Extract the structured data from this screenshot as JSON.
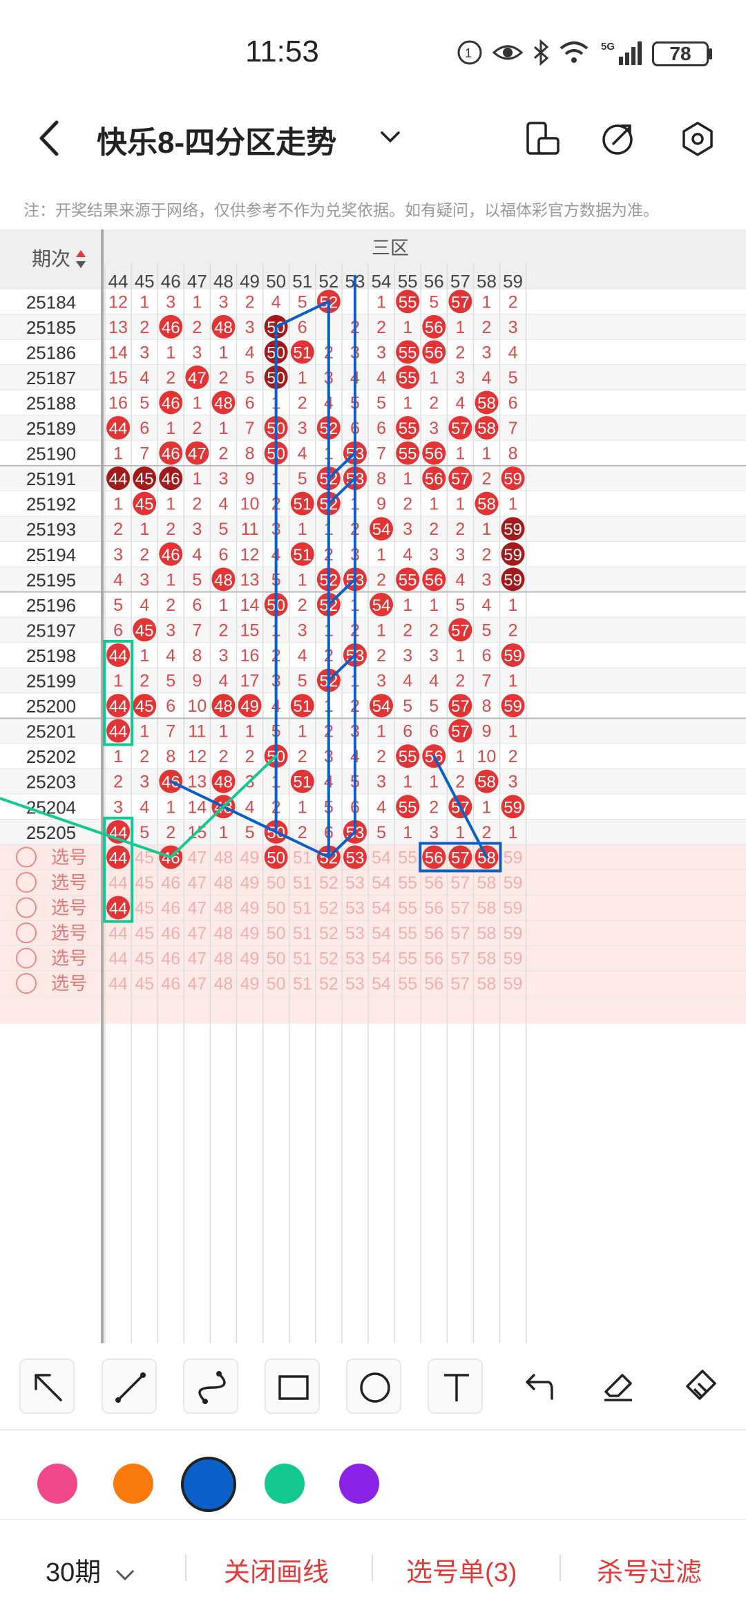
{
  "status_bar": {
    "time": "11:53",
    "battery": "78"
  },
  "header": {
    "title": "快乐8-四分区走势"
  },
  "notice": "注：开奖结果来源于网络，仅供参考不作为兑奖依据。如有疑问，以福体彩官方数据为准。",
  "table": {
    "period_header": "期次",
    "zone_label": "三区",
    "columns": [
      44,
      45,
      46,
      47,
      48,
      49,
      50,
      51,
      52,
      53,
      54,
      55,
      56,
      57,
      58,
      59
    ],
    "rows": [
      {
        "period": "25184",
        "cells": [
          "12",
          "1",
          "3",
          "1",
          "3",
          "2",
          "4",
          "5",
          "52",
          "",
          "1",
          "55",
          "5",
          "57",
          "1",
          "2"
        ]
      },
      {
        "period": "25185",
        "cells": [
          "13",
          "2",
          "46",
          "2",
          "48",
          "3",
          "50",
          "6",
          "",
          "2",
          "2",
          "1",
          "56",
          "1",
          "2",
          "3"
        ]
      },
      {
        "period": "25186",
        "cells": [
          "14",
          "3",
          "1",
          "3",
          "1",
          "4",
          "50",
          "51",
          "2",
          "3",
          "3",
          "55",
          "56",
          "2",
          "3",
          "4"
        ]
      },
      {
        "period": "25187",
        "cells": [
          "15",
          "4",
          "2",
          "47",
          "2",
          "5",
          "50",
          "1",
          "3",
          "4",
          "4",
          "55",
          "1",
          "3",
          "4",
          "5"
        ]
      },
      {
        "period": "25188",
        "cells": [
          "16",
          "5",
          "46",
          "1",
          "48",
          "6",
          "1",
          "2",
          "4",
          "5",
          "5",
          "1",
          "2",
          "4",
          "58",
          "6"
        ]
      },
      {
        "period": "25189",
        "cells": [
          "44",
          "6",
          "1",
          "2",
          "1",
          "7",
          "50",
          "3",
          "52",
          "6",
          "6",
          "55",
          "3",
          "57",
          "58",
          "7"
        ]
      },
      {
        "period": "25190",
        "cells": [
          "1",
          "7",
          "46",
          "47",
          "2",
          "8",
          "50",
          "4",
          "1",
          "53",
          "7",
          "55",
          "56",
          "1",
          "1",
          "8"
        ]
      },
      {
        "period": "25191",
        "cells": [
          "44",
          "45",
          "46",
          "1",
          "3",
          "9",
          "1",
          "5",
          "52",
          "53",
          "8",
          "1",
          "56",
          "57",
          "2",
          "59"
        ]
      },
      {
        "period": "25192",
        "cells": [
          "1",
          "45",
          "1",
          "2",
          "4",
          "10",
          "2",
          "51",
          "52",
          "1",
          "9",
          "2",
          "1",
          "1",
          "58",
          "1"
        ]
      },
      {
        "period": "25193",
        "cells": [
          "2",
          "1",
          "2",
          "3",
          "5",
          "11",
          "3",
          "1",
          "1",
          "2",
          "54",
          "3",
          "2",
          "2",
          "1",
          "59"
        ]
      },
      {
        "period": "25194",
        "cells": [
          "3",
          "2",
          "46",
          "4",
          "6",
          "12",
          "4",
          "51",
          "2",
          "3",
          "1",
          "4",
          "3",
          "3",
          "2",
          "59"
        ]
      },
      {
        "period": "25195",
        "cells": [
          "4",
          "3",
          "1",
          "5",
          "48",
          "13",
          "5",
          "1",
          "52",
          "53",
          "2",
          "55",
          "56",
          "4",
          "3",
          "59"
        ]
      },
      {
        "period": "25196",
        "cells": [
          "5",
          "4",
          "2",
          "6",
          "1",
          "14",
          "50",
          "2",
          "52",
          "1",
          "54",
          "1",
          "1",
          "5",
          "4",
          "1"
        ]
      },
      {
        "period": "25197",
        "cells": [
          "6",
          "45",
          "3",
          "7",
          "2",
          "15",
          "1",
          "3",
          "1",
          "2",
          "1",
          "2",
          "2",
          "57",
          "5",
          "2"
        ]
      },
      {
        "period": "25198",
        "cells": [
          "44",
          "1",
          "4",
          "8",
          "3",
          "16",
          "2",
          "4",
          "2",
          "53",
          "2",
          "3",
          "3",
          "1",
          "6",
          "59"
        ]
      },
      {
        "period": "25199",
        "cells": [
          "1",
          "2",
          "5",
          "9",
          "4",
          "17",
          "3",
          "5",
          "52",
          "1",
          "3",
          "4",
          "4",
          "2",
          "7",
          "1"
        ]
      },
      {
        "period": "25200",
        "cells": [
          "44",
          "45",
          "6",
          "10",
          "48",
          "49",
          "4",
          "51",
          "1",
          "2",
          "54",
          "5",
          "5",
          "57",
          "8",
          "59"
        ]
      },
      {
        "period": "25201",
        "cells": [
          "44",
          "1",
          "7",
          "11",
          "1",
          "1",
          "5",
          "1",
          "2",
          "3",
          "1",
          "6",
          "6",
          "57",
          "9",
          "1"
        ]
      },
      {
        "period": "25202",
        "cells": [
          "1",
          "2",
          "8",
          "12",
          "2",
          "2",
          "50",
          "2",
          "3",
          "4",
          "2",
          "55",
          "56",
          "1",
          "10",
          "2"
        ]
      },
      {
        "period": "25203",
        "cells": [
          "2",
          "3",
          "46",
          "13",
          "48",
          "3",
          "1",
          "51",
          "4",
          "5",
          "3",
          "1",
          "1",
          "2",
          "58",
          "3"
        ]
      },
      {
        "period": "25204",
        "cells": [
          "3",
          "4",
          "1",
          "14",
          "48",
          "4",
          "2",
          "1",
          "5",
          "6",
          "4",
          "55",
          "2",
          "57",
          "1",
          "59"
        ]
      },
      {
        "period": "25205",
        "cells": [
          "44",
          "5",
          "2",
          "15",
          "1",
          "5",
          "50",
          "2",
          "6",
          "53",
          "5",
          "1",
          "3",
          "1",
          "2",
          "1"
        ]
      }
    ],
    "dark_balls": [
      [
        1,
        6
      ],
      [
        2,
        6
      ],
      [
        3,
        6
      ],
      [
        7,
        0
      ],
      [
        7,
        1
      ],
      [
        7,
        2
      ],
      [
        9,
        15
      ],
      [
        10,
        15
      ],
      [
        11,
        15
      ]
    ],
    "select_label": "选号",
    "select_rows": [
      {
        "chosen": [
          0,
          2,
          6,
          8,
          9,
          12,
          13,
          14
        ]
      },
      {
        "chosen": []
      },
      {
        "chosen": [
          0
        ]
      },
      {
        "chosen": []
      },
      {
        "chosen": []
      },
      {
        "chosen": []
      }
    ]
  },
  "tools": [
    "arrow-tool",
    "line-tool",
    "curve-tool",
    "rectangle-tool",
    "circle-tool",
    "text-tool",
    "undo-tool",
    "eraser-tool",
    "clear-tool"
  ],
  "colors": [
    "#f0488a",
    "#fb7a0c",
    "#0a5fc8",
    "#14c98f",
    "#8a23e6"
  ],
  "selected_color": "#0a5fc8",
  "bottom_bar": {
    "period_select": "30期",
    "close_drawing": "关闭画线",
    "selection_list": "选号单(3)",
    "filter": "杀号过滤"
  }
}
